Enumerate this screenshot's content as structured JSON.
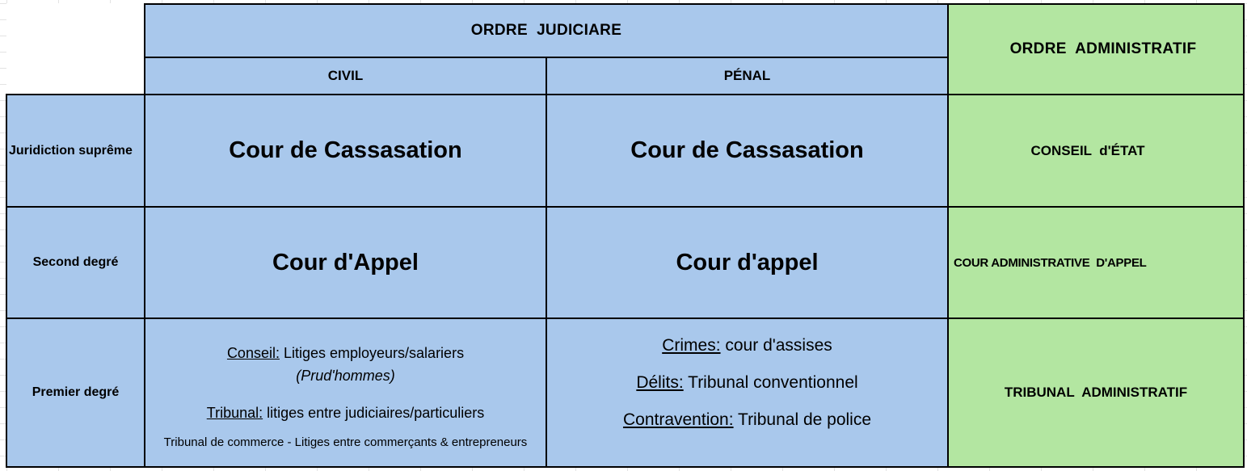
{
  "header": {
    "ordre_judiciaire": "ORDRE  JUDICIARE",
    "ordre_administratif": "ORDRE  ADMINISTRATIF",
    "civil": "CIVIL",
    "penal": "PÉNAL"
  },
  "rows": {
    "supreme": {
      "label": "Juridiction suprême",
      "civil": "Cour de Cassasation",
      "penal": "Cour de Cassasation",
      "admin": "CONSEIL  d'ÉTAT"
    },
    "second": {
      "label": "Second degré",
      "civil": "Cour d'Appel",
      "penal": "Cour d'appel",
      "admin": "COUR ADMINISTRATIVE  D'APPEL"
    },
    "premier": {
      "label": "Premier degré",
      "civil": {
        "conseil_term": "Conseil:",
        "conseil_text": " Litiges employeurs/salariers",
        "prudhommes": "(Prud'hommes)",
        "tribunal_term": "Tribunal:",
        "tribunal_text": " litiges entre judiciaires/particuliers",
        "commerce": "Tribunal de commerce - Litiges entre commerçants & entrepreneurs"
      },
      "penal": {
        "crimes_term": "Crimes:",
        "crimes_text": " cour d'assises",
        "delits_term": "Délits:",
        "delits_text": " Tribunal conventionnel",
        "contravention_term": "Contravention:",
        "contravention_text": " Tribunal de police"
      },
      "admin": "TRIBUNAL  ADMINISTRATIF"
    }
  },
  "colors": {
    "judiciaire": "#a9c8ec",
    "administratif": "#b3e6a1"
  }
}
